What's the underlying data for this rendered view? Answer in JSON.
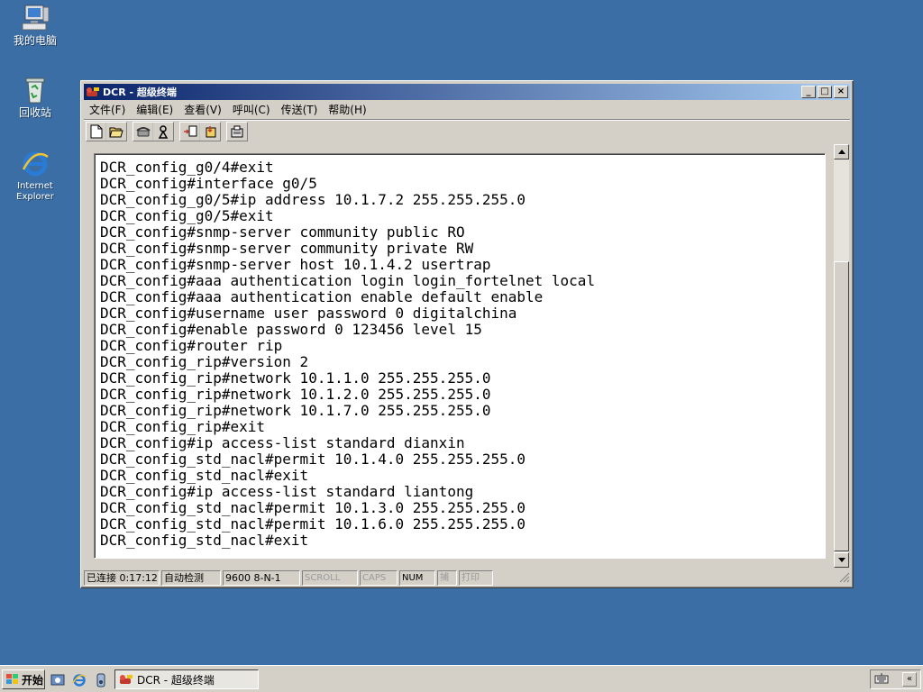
{
  "desktop": {
    "icons": [
      {
        "label": "我的电脑"
      },
      {
        "label": "回收站"
      },
      {
        "label_line1": "Internet",
        "label_line2": "Explorer"
      }
    ]
  },
  "window": {
    "title": "DCR - 超级终端",
    "controls": {
      "minimize": "_",
      "maximize": "□",
      "close": "×"
    },
    "menu": [
      "文件(F)",
      "编辑(E)",
      "查看(V)",
      "呼叫(C)",
      "传送(T)",
      "帮助(H)"
    ],
    "terminal_lines": [
      "DCR_config_g0/4#exit",
      "DCR_config#interface g0/5",
      "DCR_config_g0/5#ip address 10.1.7.2 255.255.255.0",
      "DCR_config_g0/5#exit",
      "DCR_config#snmp-server community public RO",
      "DCR_config#snmp-server community private RW",
      "DCR_config#snmp-server host 10.1.4.2 usertrap",
      "DCR_config#aaa authentication login login_fortelnet local",
      "DCR_config#aaa authentication enable default enable",
      "DCR_config#username user password 0 digitalchina",
      "DCR_config#enable password 0 123456 level 15",
      "DCR_config#router rip",
      "DCR_config_rip#version 2",
      "DCR_config_rip#network 10.1.1.0 255.255.255.0",
      "DCR_config_rip#network 10.1.2.0 255.255.255.0",
      "DCR_config_rip#network 10.1.7.0 255.255.255.0",
      "DCR_config_rip#exit",
      "DCR_config#ip access-list standard dianxin",
      "DCR_config_std_nacl#permit 10.1.4.0 255.255.255.0",
      "DCR_config_std_nacl#exit",
      "DCR_config#ip access-list standard liantong",
      "DCR_config_std_nacl#permit 10.1.3.0 255.255.255.0",
      "DCR_config_std_nacl#permit 10.1.6.0 255.255.255.0",
      "DCR_config_std_nacl#exit"
    ],
    "status": {
      "connected": "已连接 0:17:12",
      "detect": "自动检测",
      "params": "9600 8-N-1",
      "scroll": "SCROLL",
      "caps": "CAPS",
      "num": "NUM",
      "capture": "捕",
      "print": "打印"
    }
  },
  "taskbar": {
    "start_label": "开始",
    "task_label": "DCR - 超级终端",
    "tray_chevron": "«"
  },
  "colors": {
    "desktop": "#3a6ea5",
    "titlebar_start": "#0a246a",
    "titlebar_end": "#a6caf0",
    "chrome": "#d4d0c8"
  }
}
